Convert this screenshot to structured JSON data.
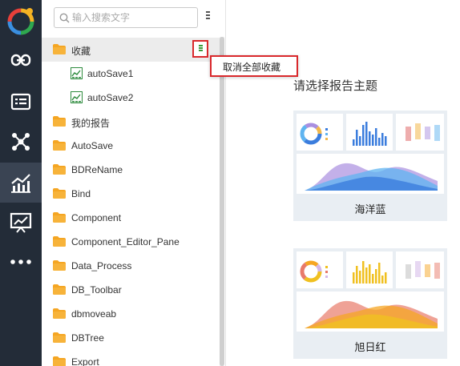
{
  "search": {
    "placeholder": "输入搜索文字",
    "value": ""
  },
  "tree": [
    {
      "label": "收藏",
      "type": "folder",
      "level": 0,
      "selected": true
    },
    {
      "label": "autoSave1",
      "type": "report",
      "level": 1
    },
    {
      "label": "autoSave2",
      "type": "report",
      "level": 1
    },
    {
      "label": "我的报告",
      "type": "folder",
      "level": 0
    },
    {
      "label": "AutoSave",
      "type": "folder",
      "level": 0
    },
    {
      "label": "BDReName",
      "type": "folder",
      "level": 0
    },
    {
      "label": "Bind",
      "type": "folder",
      "level": 0
    },
    {
      "label": "Component",
      "type": "folder",
      "level": 0
    },
    {
      "label": "Component_Editor_Pane",
      "type": "folder",
      "level": 0
    },
    {
      "label": "Data_Process",
      "type": "folder",
      "level": 0
    },
    {
      "label": "DB_Toolbar",
      "type": "folder",
      "level": 0
    },
    {
      "label": "dbmoveab",
      "type": "folder",
      "level": 0
    },
    {
      "label": "DBTree",
      "type": "folder",
      "level": 0
    },
    {
      "label": "Export",
      "type": "folder",
      "level": 0
    }
  ],
  "context_menu": {
    "item": "取消全部收藏"
  },
  "main": {
    "title": "请选择报告主题",
    "themes": [
      {
        "name": "海洋蓝",
        "colors": [
          "#3b7ddd",
          "#5fb4f0",
          "#a98fe0",
          "#f2b84b",
          "#e06a6a"
        ]
      },
      {
        "name": "旭日红",
        "colors": [
          "#f0c020",
          "#e87a6a",
          "#f5a623",
          "#d4b8e8",
          "#c0c0c0"
        ]
      }
    ]
  },
  "rail": [
    {
      "icon": "link-icon"
    },
    {
      "icon": "list-card-icon"
    },
    {
      "icon": "network-icon"
    },
    {
      "icon": "bar-chart-icon",
      "active": true
    },
    {
      "icon": "presentation-chart-icon"
    },
    {
      "icon": "more-icon"
    }
  ],
  "colors": {
    "rail_bg": "#232c38",
    "rail_active": "#3a4453",
    "folder": "#f5a623",
    "report_green": "#2e8b3e",
    "highlight_red": "#d9282c"
  }
}
